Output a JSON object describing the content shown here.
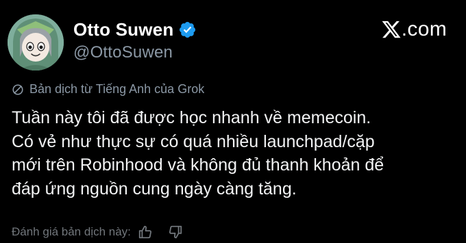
{
  "author": {
    "display_name": "Otto Suwen",
    "handle": "@OttoSuwen",
    "verified": true,
    "verified_color": "#1d9bf0"
  },
  "brand": {
    "text": ".com",
    "icon": "x-logo-icon"
  },
  "translation": {
    "label": "Bản dịch từ Tiếng Anh của Grok",
    "icon": "globe-off-icon"
  },
  "tweet": {
    "text": "Tuần này tôi đã được học nhanh về memecoin.\nCó vẻ như thực sự có quá nhiều launchpad/cặp\nmới trên Robinhood và không đủ thanh khoản để\nđáp ứng nguồn cung ngày càng tăng."
  },
  "rating": {
    "label": "Đánh giá bản dịch này:",
    "up_icon": "thumbs-up-icon",
    "down_icon": "thumbs-down-icon"
  },
  "colors": {
    "background": "#000000",
    "primary_text": "#e7e9ea",
    "secondary_text": "#8b98a5"
  }
}
